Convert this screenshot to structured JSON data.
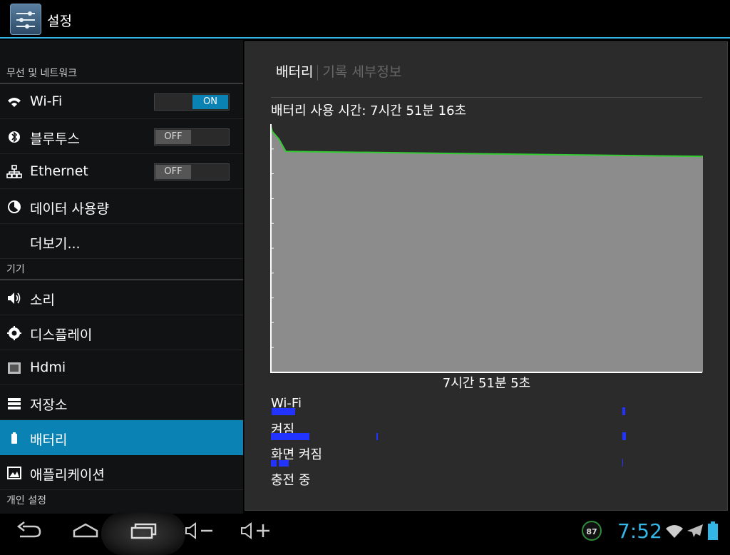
{
  "actionbar": {
    "title": "설정",
    "icon": "settings-icon"
  },
  "sidebar": {
    "sections": [
      {
        "label": "무선 및 네트워크",
        "items": [
          {
            "label": "Wi-Fi",
            "icon": "wifi-icon",
            "toggle": "ON"
          },
          {
            "label": "블루투스",
            "icon": "bluetooth-icon",
            "toggle": "OFF"
          },
          {
            "label": "Ethernet",
            "icon": "ethernet-icon",
            "toggle": "OFF"
          },
          {
            "label": "데이터 사용량",
            "icon": "data-usage-icon"
          },
          {
            "label": "더보기..."
          }
        ]
      },
      {
        "label": "기기",
        "items": [
          {
            "label": "소리",
            "icon": "volume-icon"
          },
          {
            "label": "디스플레이",
            "icon": "brightness-icon"
          },
          {
            "label": "Hdmi",
            "icon": "hdmi-icon"
          },
          {
            "label": "저장소",
            "icon": "storage-icon"
          },
          {
            "label": "배터리",
            "icon": "battery-icon",
            "selected": true
          },
          {
            "label": "애플리케이션",
            "icon": "applications-icon"
          }
        ]
      },
      {
        "label": "개인 설정",
        "items": []
      }
    ]
  },
  "content": {
    "tab_active": "배터리",
    "tab_inactive": "기록 세부정보",
    "usage_text": "배터리 사용 시간: 7시간 51분 16초",
    "graph_time": "7시간 51분 5초",
    "rows": [
      "Wi-Fi",
      "켜짐",
      "화면 켜짐",
      "충전 중"
    ]
  },
  "chart_data": {
    "type": "area",
    "title": "",
    "x_range": [
      "0",
      "7시간 51분 5초"
    ],
    "ylim": [
      0,
      100
    ],
    "x": [
      0,
      0.005,
      0.02,
      0.036,
      1
    ],
    "values": [
      100,
      97,
      94,
      89,
      87
    ],
    "series": [
      {
        "name": "",
        "color": "#33cc33",
        "fill": "#8c8c8c"
      }
    ],
    "grid": false
  },
  "navbar": {
    "buttons": [
      "back-icon",
      "home-icon",
      "recent-apps-icon",
      "volume-down-icon",
      "volume-up-icon"
    ],
    "battery_badge": "87",
    "clock": "7:52",
    "status_icons": [
      "wifi-signal-icon",
      "airplane-mode-icon",
      "battery-status-icon"
    ]
  },
  "colors": {
    "accent": "#33b5e5",
    "selected": "#0a82b4",
    "graph_line": "#33cc33",
    "graph_fill": "#8c8c8c",
    "bar": "#2233ff"
  }
}
